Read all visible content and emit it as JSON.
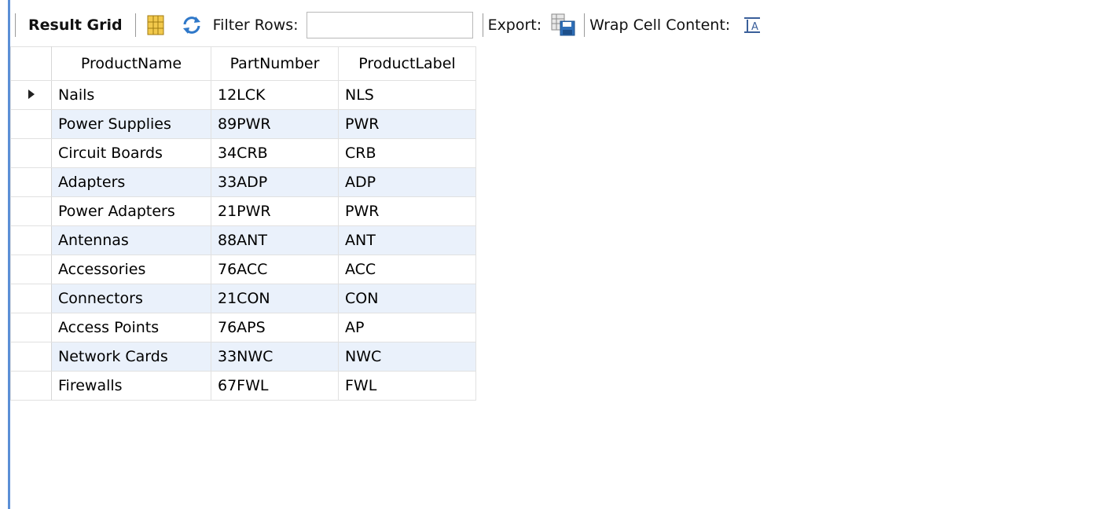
{
  "toolbar": {
    "result_grid_label": "Result Grid",
    "filter_label": "Filter Rows:",
    "filter_value": "",
    "export_label": "Export:",
    "wrap_label": "Wrap Cell Content:",
    "icons": [
      "grid-layout-icon",
      "refresh-icon",
      "export-save-icon",
      "wrap-text-icon"
    ]
  },
  "grid": {
    "columns": [
      "ProductName",
      "PartNumber",
      "ProductLabel"
    ],
    "current_row_index": 0,
    "rows": [
      {
        "name": "Nails",
        "part": "12LCK",
        "label": "NLS"
      },
      {
        "name": "Power Supplies",
        "part": "89PWR",
        "label": "PWR"
      },
      {
        "name": "Circuit Boards",
        "part": "34CRB",
        "label": "CRB"
      },
      {
        "name": "Adapters",
        "part": "33ADP",
        "label": "ADP"
      },
      {
        "name": "Power Adapters",
        "part": "21PWR",
        "label": "PWR"
      },
      {
        "name": "Antennas",
        "part": "88ANT",
        "label": "ANT"
      },
      {
        "name": "Accessories",
        "part": "76ACC",
        "label": "ACC"
      },
      {
        "name": "Connectors",
        "part": "21CON",
        "label": "CON"
      },
      {
        "name": "Access Points",
        "part": "76APS",
        "label": "AP"
      },
      {
        "name": "Network Cards",
        "part": "33NWC",
        "label": "NWC"
      },
      {
        "name": "Firewalls",
        "part": "67FWL",
        "label": "FWL"
      }
    ]
  },
  "colors": {
    "accent": "#5b8fd6",
    "alt_row": "#eaf1fb"
  }
}
